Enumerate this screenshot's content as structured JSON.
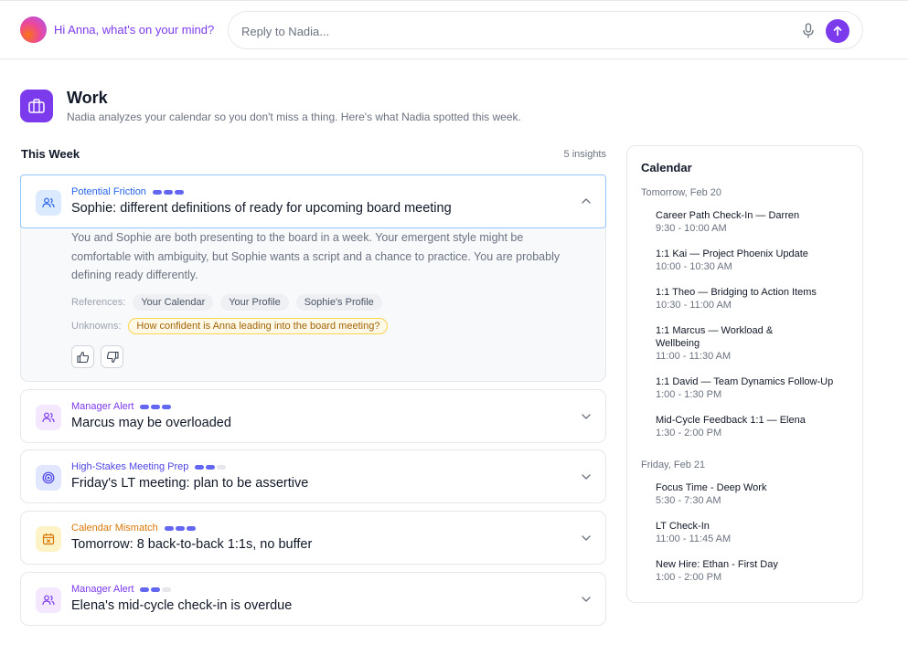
{
  "topbar": {
    "greeting": "Hi Anna, what's on your mind?",
    "reply_placeholder": "Reply to Nadia..."
  },
  "header": {
    "title": "Work",
    "subtitle": "Nadia analyzes your calendar so you don't miss a thing. Here's what Nadia spotted this week."
  },
  "section": {
    "label": "This Week",
    "count_text": "5 insights"
  },
  "insights": [
    {
      "category": "Potential Friction",
      "category_color": "#2563eb",
      "severity": 3,
      "title": "Sophie: different definitions of ready for upcoming board meeting",
      "body": "You and Sophie are both presenting to the board in a week. Your emergent style might be comfortable with ambiguity, but Sophie wants a script and a chance to practice. You are probably defining ready differently.",
      "references_label": "References:",
      "references": [
        "Your Calendar",
        "Your Profile",
        "Sophie's Profile"
      ],
      "unknowns_label": "Unknowns:",
      "unknowns": [
        "How confident is Anna leading into the board meeting?"
      ],
      "icon": "people-icon",
      "expanded": true
    },
    {
      "category": "Manager Alert",
      "category_color": "#7c3aed",
      "severity": 3,
      "title": "Marcus may be overloaded",
      "icon": "people-icon"
    },
    {
      "category": "High-Stakes Meeting Prep",
      "category_color": "#4f46e5",
      "severity": 2,
      "title": "Friday's LT meeting: plan to be assertive",
      "icon": "target-icon"
    },
    {
      "category": "Calendar Mismatch",
      "category_color": "#d97706",
      "severity": 3,
      "title": "Tomorrow: 8 back-to-back 1:1s, no buffer",
      "icon": "calendar-x-icon"
    },
    {
      "category": "Manager Alert",
      "category_color": "#7c3aed",
      "severity": 2,
      "title": "Elena's mid-cycle check-in is overdue",
      "icon": "people-icon"
    }
  ],
  "calendar": {
    "title": "Calendar",
    "days": [
      {
        "label": "Tomorrow, Feb 20",
        "events": [
          {
            "title": "Career Path Check-In — Darren",
            "time": "9:30 - 10:00 AM"
          },
          {
            "title": "1:1 Kai — Project Phoenix Update",
            "time": "10:00 - 10:30 AM"
          },
          {
            "title": "1:1 Theo — Bridging to Action Items",
            "time": "10:30 - 11:00 AM"
          },
          {
            "title": "1:1 Marcus — Workload & Wellbeing",
            "time": "11:00 - 11:30 AM"
          },
          {
            "title": "1:1 David — Team Dynamics Follow-Up",
            "time": "1:00 - 1:30 PM"
          },
          {
            "title": "Mid-Cycle Feedback 1:1 — Elena",
            "time": "1:30 - 2:00 PM"
          }
        ]
      },
      {
        "label": "Friday, Feb 21",
        "events": [
          {
            "title": "Focus Time - Deep Work",
            "time": "5:30 - 7:30 AM"
          },
          {
            "title": "LT Check-In",
            "time": "11:00 - 11:45 AM"
          },
          {
            "title": "New Hire: Ethan - First Day",
            "time": "1:00 - 2:00 PM"
          }
        ]
      }
    ]
  },
  "colors": {
    "accent": "#7c3aed",
    "friction": "#2563eb",
    "warning": "#d97706"
  }
}
